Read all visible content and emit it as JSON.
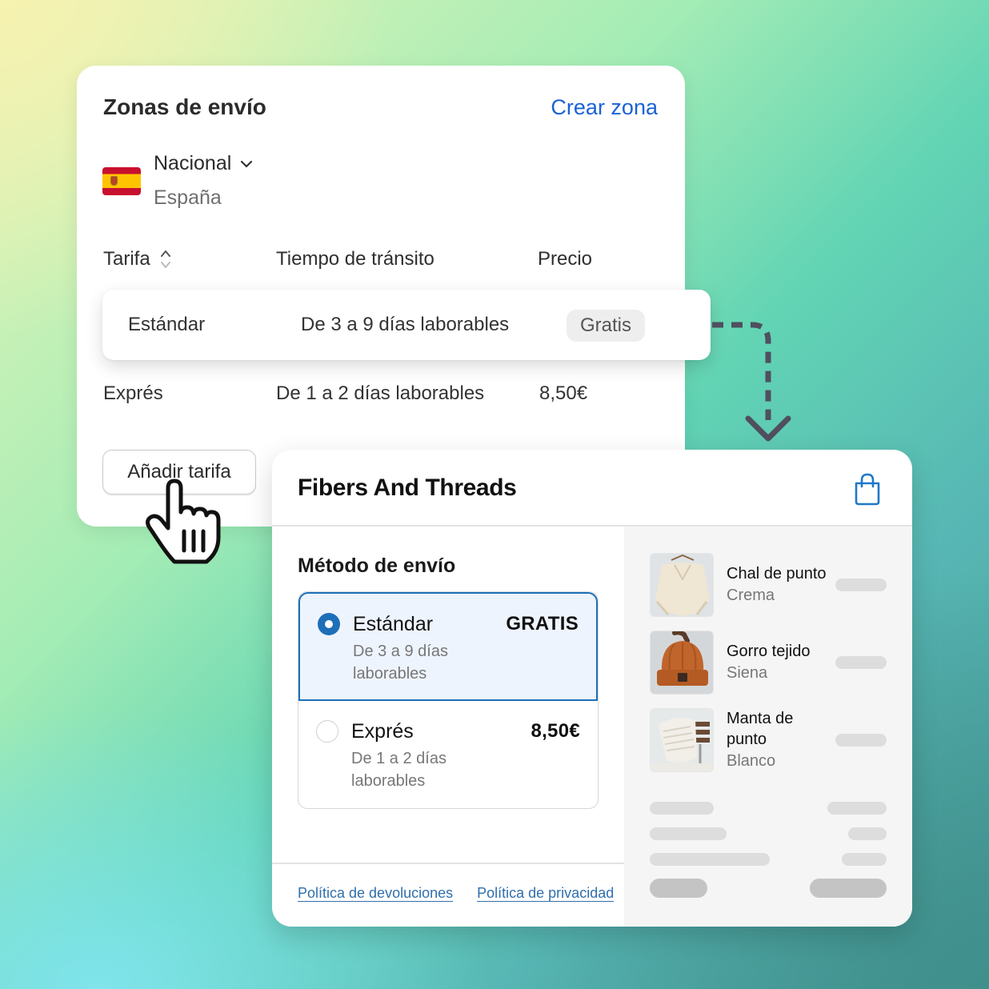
{
  "zones_card": {
    "title": "Zonas de envío",
    "create_zone_label": "Crear zona",
    "zone": {
      "flag": "spain-flag-icon",
      "name": "Nacional",
      "country": "España"
    },
    "table": {
      "headers": [
        "Tarifa",
        "Tiempo de tránsito",
        "Precio"
      ],
      "rows": [
        {
          "rate": "Estándar",
          "transit": "De 3 a 9 días laborables",
          "price": "Gratis"
        },
        {
          "rate": "Exprés",
          "transit": "De 1 a 2 días laborables",
          "price": "8,50€"
        }
      ]
    },
    "add_rate_label": "Añadir tarifa"
  },
  "checkout": {
    "store_name": "Fibers And Threads",
    "cart_icon": "shopping-bag-icon",
    "shipping_method_title": "Método de envío",
    "options": [
      {
        "name": "Estándar",
        "description": "De 3 a 9 días laborables",
        "price": "GRATIS",
        "selected": true
      },
      {
        "name": "Exprés",
        "description": "De 1 a 2 días laborables",
        "price": "8,50€",
        "selected": false
      }
    ],
    "links": [
      "Política de devoluciones",
      "Política de privacidad"
    ],
    "products": [
      {
        "name": "Chal de punto",
        "variant": "Crema"
      },
      {
        "name": "Gorro tejido",
        "variant": "Siena"
      },
      {
        "name": "Manta de punto",
        "variant": "Blanco"
      }
    ]
  },
  "colors": {
    "accent_link": "#1a62d6",
    "selected_blue": "#1d6fb8",
    "selected_bg": "#eef4fd"
  }
}
